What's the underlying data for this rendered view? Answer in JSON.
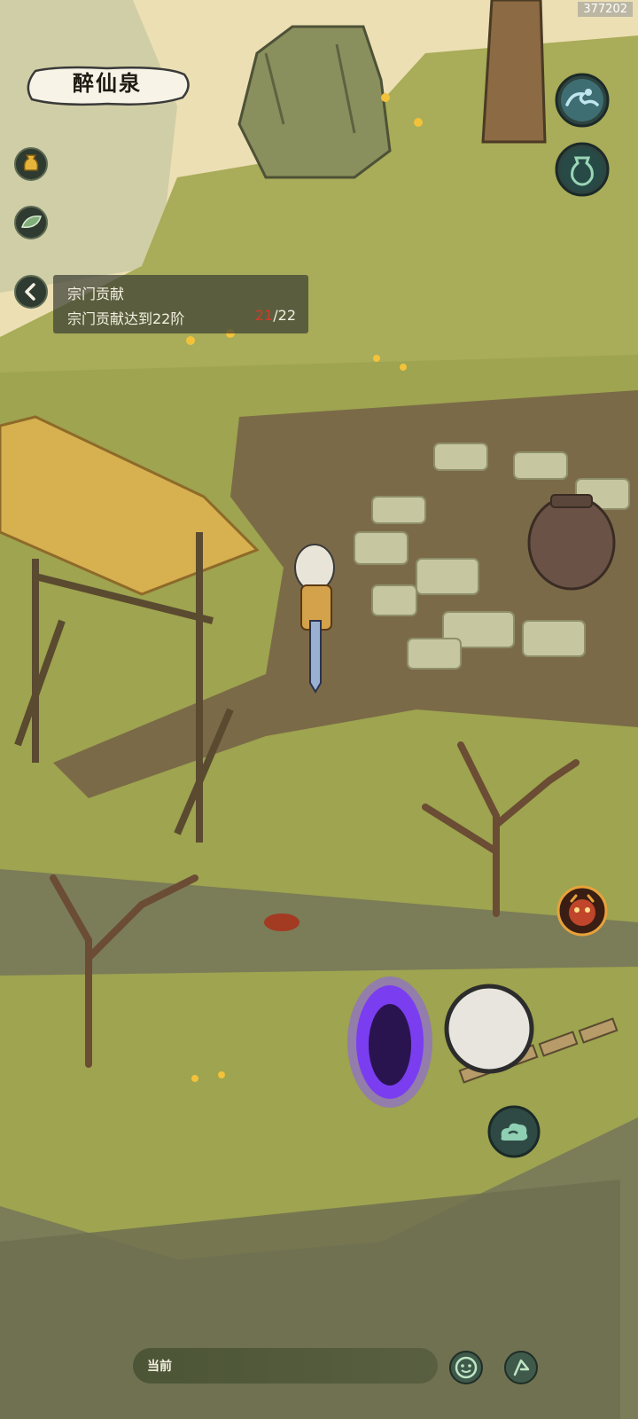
{
  "watermark": {
    "uid": "377202"
  },
  "location": {
    "name": "醉仙泉"
  },
  "quest": {
    "title": "宗门贡献",
    "description": "宗门贡献达到22阶",
    "progress_current": "21",
    "progress_separator": "/",
    "progress_total": "22"
  },
  "chat": {
    "channel_label": "当前"
  },
  "icons": {
    "left_top": "gold-pouch-icon",
    "left_second": "leaf-icon",
    "right_top": "water-wave-icon",
    "right_second": "jar-icon",
    "monster_skill": "demon-face-icon",
    "cloud": "cloud-icon",
    "emote": "smile-icon",
    "settings": "flag-icon"
  },
  "colors": {
    "accent_red": "#d23a2a",
    "panel_bg": "#3c4034",
    "portal": "#7b3df0"
  }
}
